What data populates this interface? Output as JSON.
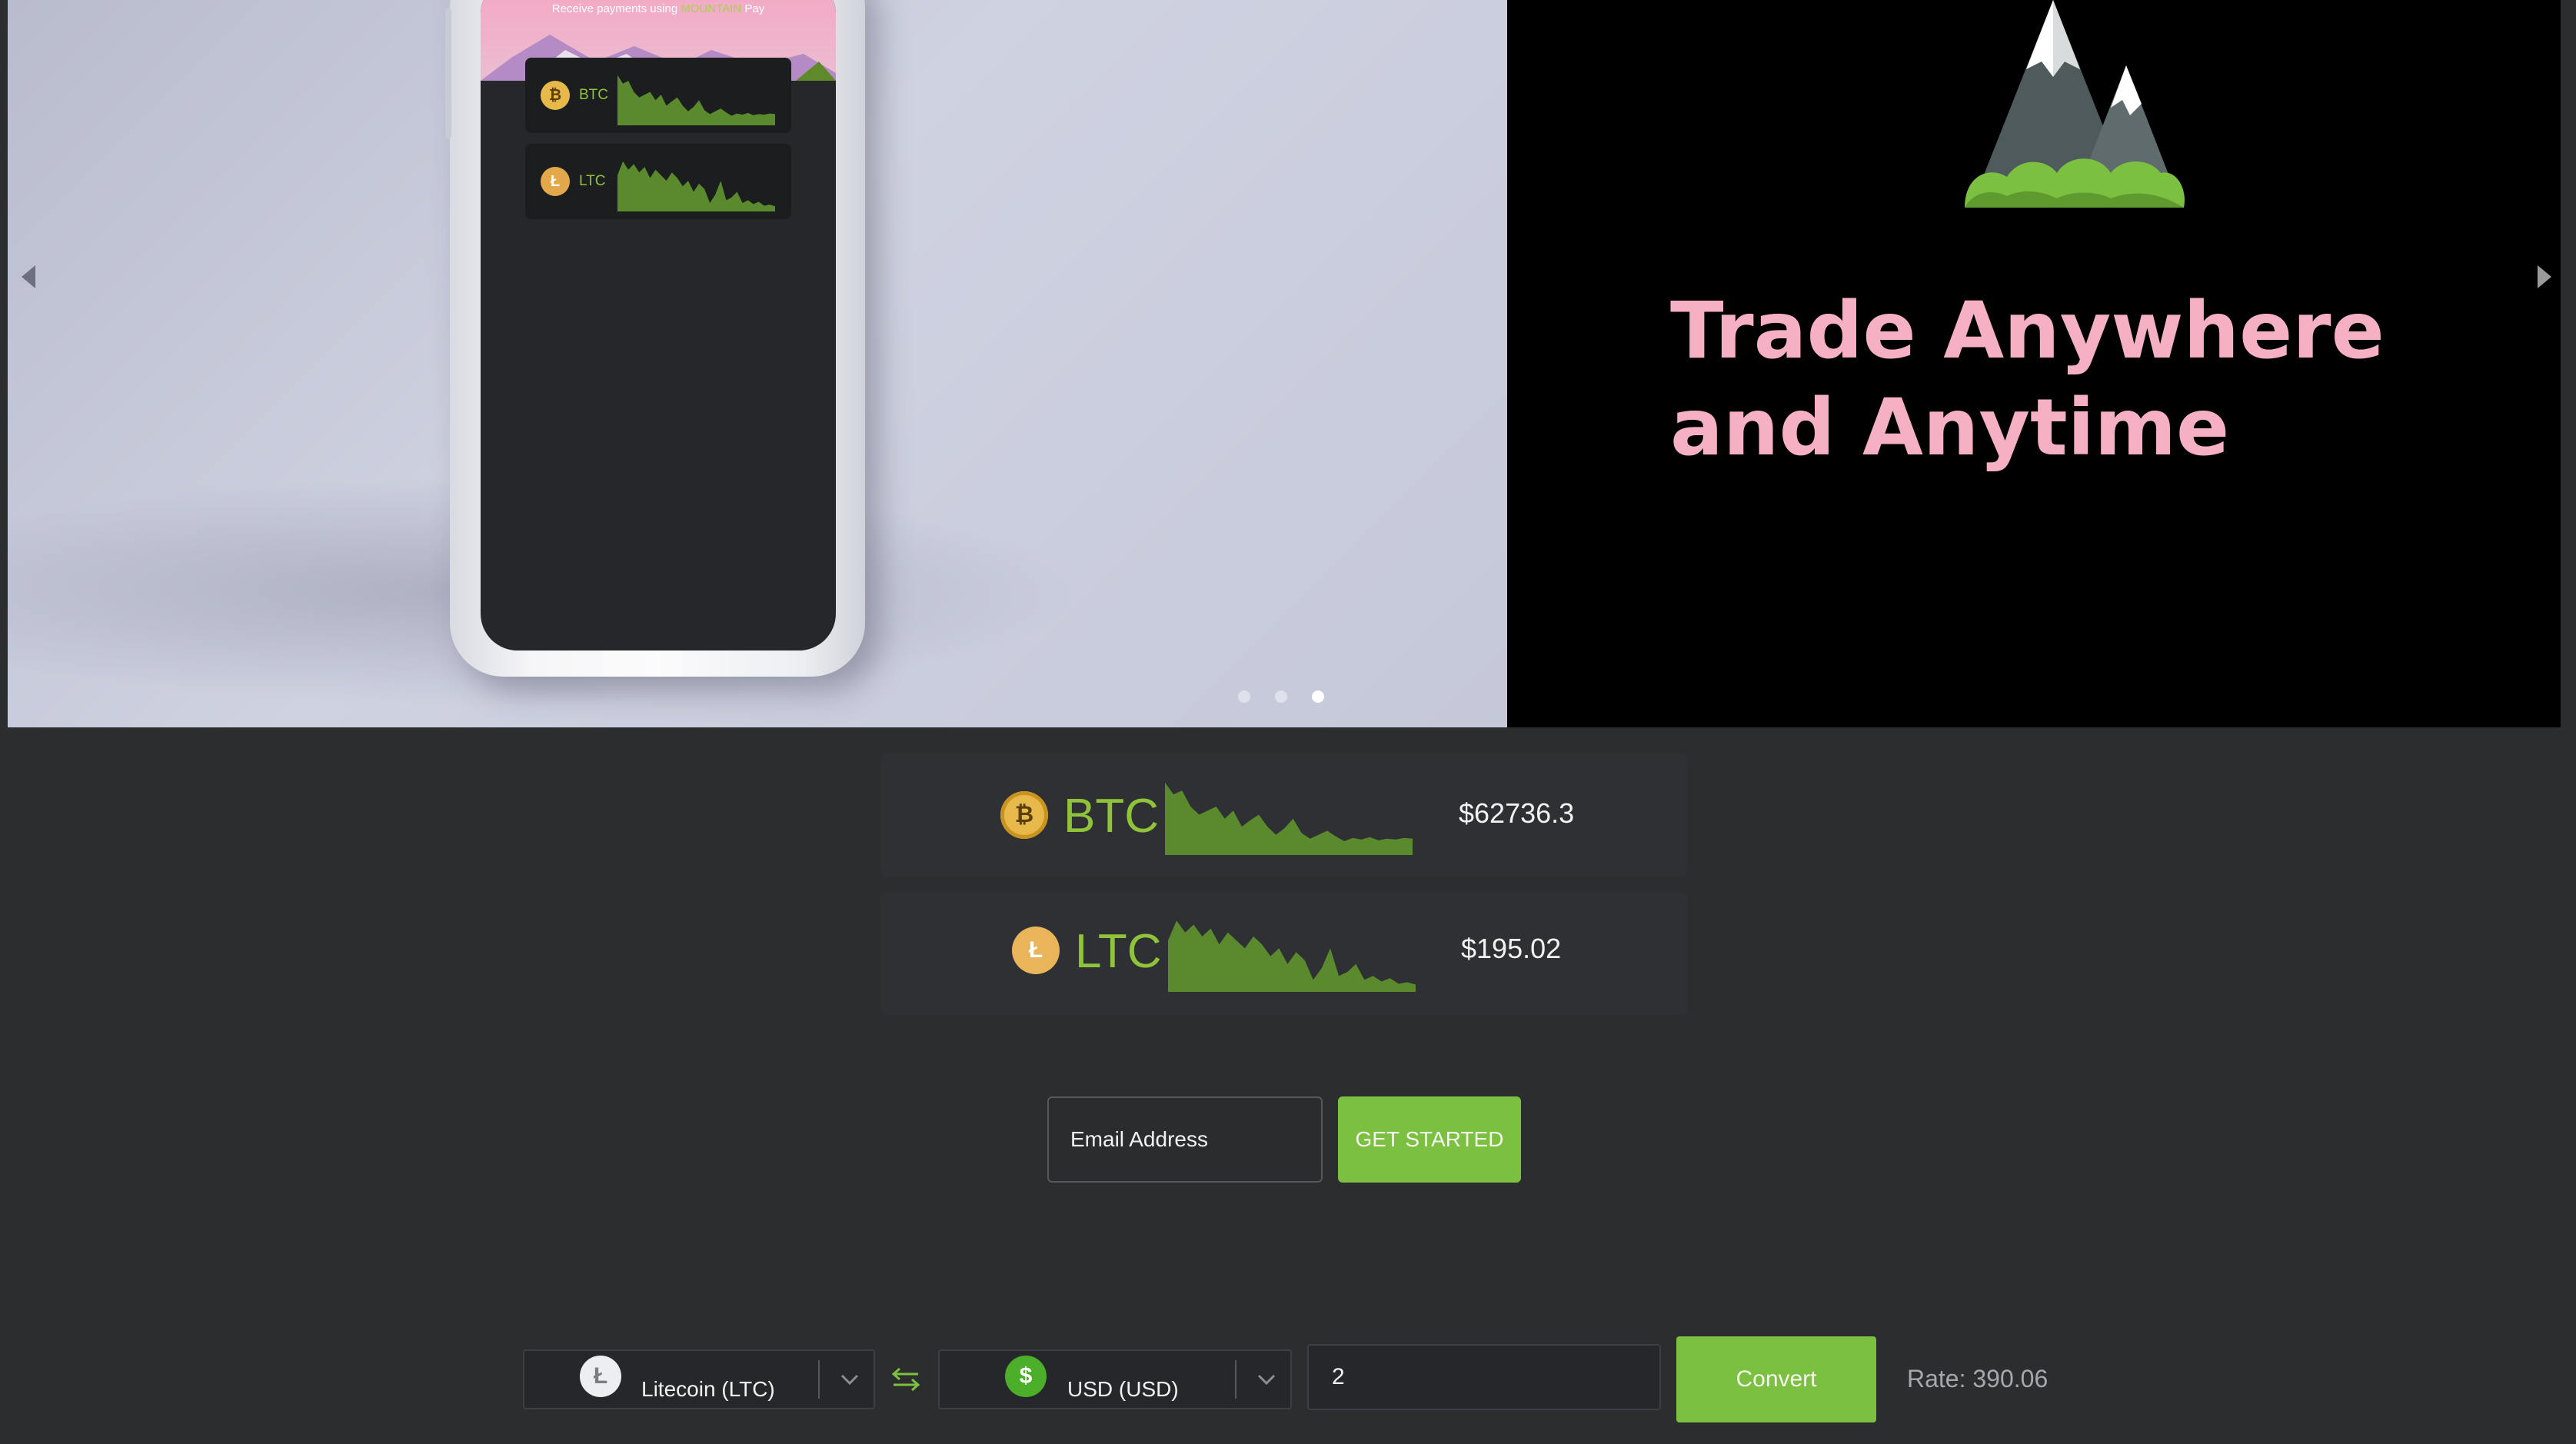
{
  "carousel": {
    "phone_banner": {
      "prefix": "Receive payments using ",
      "brand": "MOUNTAIN",
      "suffix": " Pay"
    },
    "phone_cards": [
      {
        "symbol": "BTC",
        "coin_glyph": "₿"
      },
      {
        "symbol": "LTC",
        "coin_glyph": "Ł"
      }
    ],
    "headline": "Trade Anywhere and Anytime",
    "slide_count": 3,
    "active_slide": 3
  },
  "prices": [
    {
      "symbol": "BTC",
      "price": "$62736.3",
      "coin_glyph": "₿"
    },
    {
      "symbol": "LTC",
      "price": "$195.02",
      "coin_glyph": "Ł"
    }
  ],
  "signup": {
    "email_placeholder": "Email Address",
    "button_label": "GET STARTED"
  },
  "converter": {
    "from_label": "Litecoin (LTC)",
    "from_glyph": "Ł",
    "to_label": "USD (USD)",
    "to_glyph": "$",
    "amount": "2",
    "button_label": "Convert",
    "rate": "Rate: 390.06"
  },
  "colors": {
    "accent_green": "#7cc042",
    "headline_pink": "#f6b0c3",
    "background": "#2b2d2f"
  }
}
